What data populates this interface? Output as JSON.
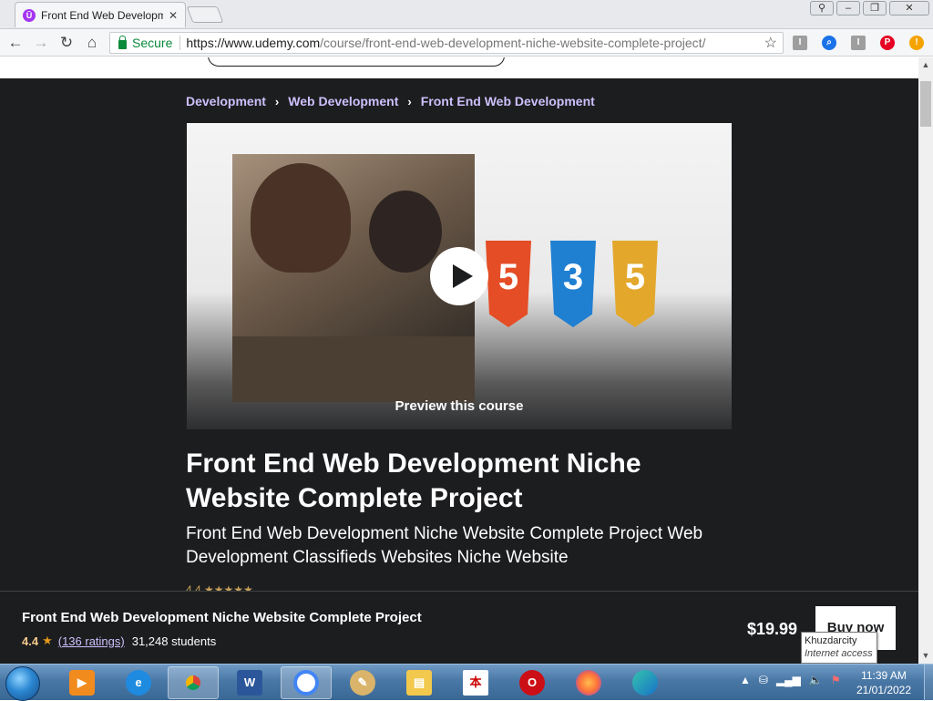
{
  "browser": {
    "tab_title": "Front End Web Developm",
    "tab_favicon": "udemy-icon",
    "url_secure_label": "Secure",
    "url_host": "https://www.udemy.com",
    "url_path": "/course/front-end-web-development-niche-website-complete-project/",
    "ext_icons": [
      "instapaper-icon",
      "search-ext-icon",
      "instapaper-icon",
      "pinterest-icon",
      "alert-ext-icon"
    ]
  },
  "breadcrumb": {
    "items": [
      "Development",
      "Web Development",
      "Front End Web Development"
    ]
  },
  "preview": {
    "label": "Preview this course",
    "shields": [
      "5",
      "3",
      "5"
    ]
  },
  "course": {
    "title": "Front End Web Development Niche Website Complete Project",
    "subtitle": "Front End Web Development Niche Website Complete Project Web Development Classifieds Websites Niche Website"
  },
  "sticky": {
    "title": "Front End Web Development Niche Website Complete Project",
    "rating": "4.4",
    "ratings_link": "(136 ratings)",
    "students": "31,248 students",
    "price": "$19.99",
    "buy_label": "Buy now"
  },
  "tooltip": {
    "network": "Khuzdarcity",
    "status": "Internet access"
  },
  "taskbar": {
    "apps": [
      "media-player",
      "internet-explorer",
      "chrome",
      "word",
      "chrome-active",
      "paint",
      "file-explorer",
      "calendar-app",
      "opera",
      "firefox",
      "edge"
    ],
    "time": "11:39 AM",
    "date": "21/01/2022"
  },
  "colors": {
    "page_bg": "#1c1d1f",
    "crumb": "#cec0fc",
    "accent": "#a435f0",
    "star": "#e59819"
  }
}
